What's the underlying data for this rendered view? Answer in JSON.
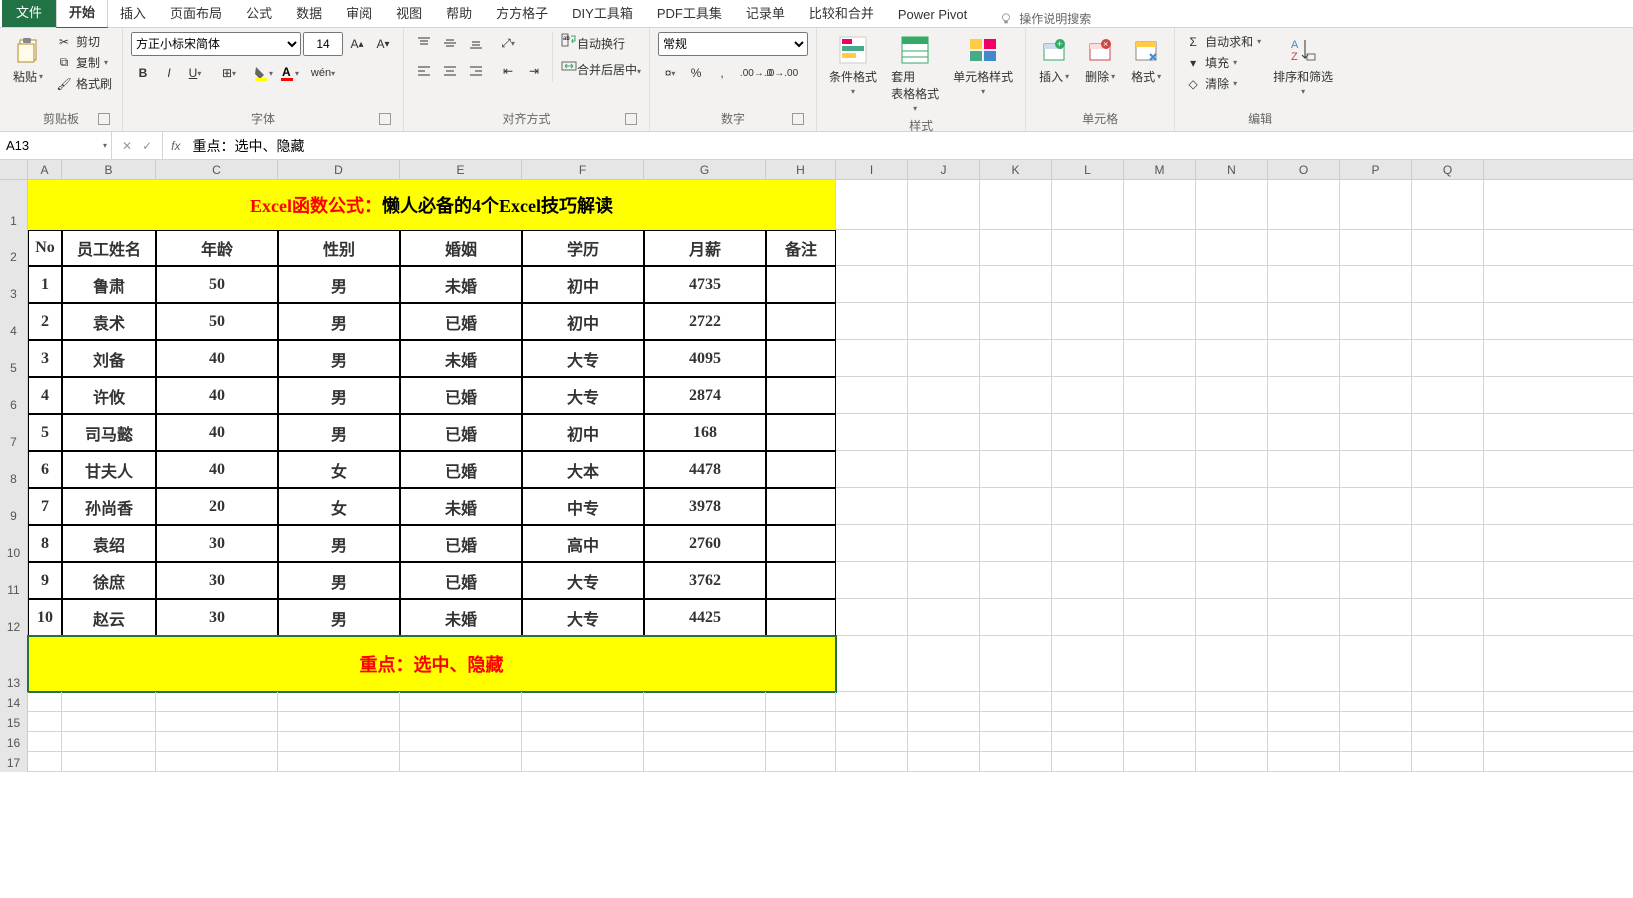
{
  "tabs": [
    "文件",
    "开始",
    "插入",
    "页面布局",
    "公式",
    "数据",
    "审阅",
    "视图",
    "帮助",
    "方方格子",
    "DIY工具箱",
    "PDF工具集",
    "记录单",
    "比较和合并",
    "Power Pivot"
  ],
  "active_tab_index": 1,
  "search_hint": "操作说明搜索",
  "clipboard": {
    "paste": "粘贴",
    "cut": "剪切",
    "copy": "复制",
    "painter": "格式刷",
    "label": "剪贴板"
  },
  "font": {
    "name": "方正小标宋简体",
    "size": "14",
    "label": "字体"
  },
  "align": {
    "wrap": "自动换行",
    "merge": "合并后居中",
    "label": "对齐方式"
  },
  "number": {
    "format": "常规",
    "label": "数字"
  },
  "styles": {
    "cond": "条件格式",
    "tbl": "套用\n表格格式",
    "cell": "单元格样式",
    "label": "样式"
  },
  "cells": {
    "ins": "插入",
    "del": "删除",
    "fmt": "格式",
    "label": "单元格"
  },
  "editing": {
    "sum": "自动求和",
    "fill": "填充",
    "clear": "清除",
    "sort": "排序和筛选",
    "label": "编辑"
  },
  "namebox": "A13",
  "formula": "重点：选中、隐藏",
  "col_widths": {
    "A": 34,
    "B": 94,
    "C": 122,
    "D": 122,
    "E": 122,
    "F": 122,
    "G": 122,
    "H": 70,
    "rest": 72
  },
  "extra_cols": [
    "I",
    "J",
    "K",
    "L",
    "M",
    "N",
    "O",
    "P",
    "Q"
  ],
  "title_row": {
    "prefix": "Excel函数公式：",
    "suffix": "懒人必备的4个Excel技巧解读"
  },
  "headers": [
    "No",
    "员工姓名",
    "年龄",
    "性别",
    "婚姻",
    "学历",
    "月薪",
    "备注"
  ],
  "data": [
    [
      "1",
      "鲁肃",
      "50",
      "男",
      "未婚",
      "初中",
      "4735",
      ""
    ],
    [
      "2",
      "袁术",
      "50",
      "男",
      "已婚",
      "初中",
      "2722",
      ""
    ],
    [
      "3",
      "刘备",
      "40",
      "男",
      "未婚",
      "大专",
      "4095",
      ""
    ],
    [
      "4",
      "许攸",
      "40",
      "男",
      "已婚",
      "大专",
      "2874",
      ""
    ],
    [
      "5",
      "司马懿",
      "40",
      "男",
      "已婚",
      "初中",
      "168",
      ""
    ],
    [
      "6",
      "甘夫人",
      "40",
      "女",
      "已婚",
      "大本",
      "4478",
      ""
    ],
    [
      "7",
      "孙尚香",
      "20",
      "女",
      "未婚",
      "中专",
      "3978",
      ""
    ],
    [
      "8",
      "袁绍",
      "30",
      "男",
      "已婚",
      "高中",
      "2760",
      ""
    ],
    [
      "9",
      "徐庶",
      "30",
      "男",
      "已婚",
      "大专",
      "3762",
      ""
    ],
    [
      "10",
      "赵云",
      "30",
      "男",
      "未婚",
      "大专",
      "4425",
      ""
    ]
  ],
  "footer": {
    "prefix": "重点：",
    "suffix": "选中、隐藏"
  },
  "row_heights": {
    "title": 50,
    "header": 36,
    "data": 37,
    "footer": 56,
    "empty": 20
  },
  "empty_rows": [
    14,
    15,
    16,
    17
  ]
}
